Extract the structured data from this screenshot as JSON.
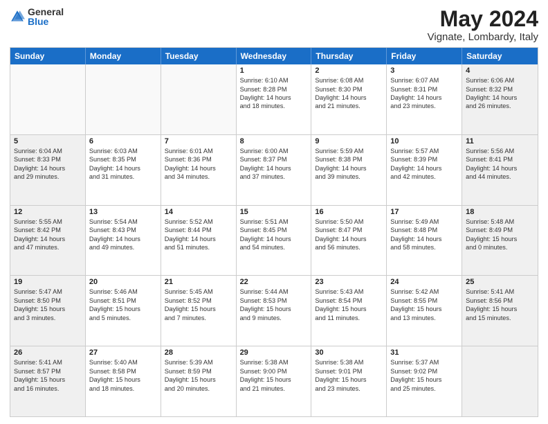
{
  "logo": {
    "general": "General",
    "blue": "Blue"
  },
  "title": {
    "month": "May 2024",
    "location": "Vignate, Lombardy, Italy"
  },
  "header_days": [
    "Sunday",
    "Monday",
    "Tuesday",
    "Wednesday",
    "Thursday",
    "Friday",
    "Saturday"
  ],
  "rows": [
    [
      {
        "day": "",
        "text": "",
        "empty": true
      },
      {
        "day": "",
        "text": "",
        "empty": true
      },
      {
        "day": "",
        "text": "",
        "empty": true
      },
      {
        "day": "1",
        "text": "Sunrise: 6:10 AM\nSunset: 8:28 PM\nDaylight: 14 hours\nand 18 minutes.",
        "empty": false
      },
      {
        "day": "2",
        "text": "Sunrise: 6:08 AM\nSunset: 8:30 PM\nDaylight: 14 hours\nand 21 minutes.",
        "empty": false
      },
      {
        "day": "3",
        "text": "Sunrise: 6:07 AM\nSunset: 8:31 PM\nDaylight: 14 hours\nand 23 minutes.",
        "empty": false
      },
      {
        "day": "4",
        "text": "Sunrise: 6:06 AM\nSunset: 8:32 PM\nDaylight: 14 hours\nand 26 minutes.",
        "empty": false,
        "shaded": true
      }
    ],
    [
      {
        "day": "5",
        "text": "Sunrise: 6:04 AM\nSunset: 8:33 PM\nDaylight: 14 hours\nand 29 minutes.",
        "empty": false,
        "shaded": true
      },
      {
        "day": "6",
        "text": "Sunrise: 6:03 AM\nSunset: 8:35 PM\nDaylight: 14 hours\nand 31 minutes.",
        "empty": false
      },
      {
        "day": "7",
        "text": "Sunrise: 6:01 AM\nSunset: 8:36 PM\nDaylight: 14 hours\nand 34 minutes.",
        "empty": false
      },
      {
        "day": "8",
        "text": "Sunrise: 6:00 AM\nSunset: 8:37 PM\nDaylight: 14 hours\nand 37 minutes.",
        "empty": false
      },
      {
        "day": "9",
        "text": "Sunrise: 5:59 AM\nSunset: 8:38 PM\nDaylight: 14 hours\nand 39 minutes.",
        "empty": false
      },
      {
        "day": "10",
        "text": "Sunrise: 5:57 AM\nSunset: 8:39 PM\nDaylight: 14 hours\nand 42 minutes.",
        "empty": false
      },
      {
        "day": "11",
        "text": "Sunrise: 5:56 AM\nSunset: 8:41 PM\nDaylight: 14 hours\nand 44 minutes.",
        "empty": false,
        "shaded": true
      }
    ],
    [
      {
        "day": "12",
        "text": "Sunrise: 5:55 AM\nSunset: 8:42 PM\nDaylight: 14 hours\nand 47 minutes.",
        "empty": false,
        "shaded": true
      },
      {
        "day": "13",
        "text": "Sunrise: 5:54 AM\nSunset: 8:43 PM\nDaylight: 14 hours\nand 49 minutes.",
        "empty": false
      },
      {
        "day": "14",
        "text": "Sunrise: 5:52 AM\nSunset: 8:44 PM\nDaylight: 14 hours\nand 51 minutes.",
        "empty": false
      },
      {
        "day": "15",
        "text": "Sunrise: 5:51 AM\nSunset: 8:45 PM\nDaylight: 14 hours\nand 54 minutes.",
        "empty": false
      },
      {
        "day": "16",
        "text": "Sunrise: 5:50 AM\nSunset: 8:47 PM\nDaylight: 14 hours\nand 56 minutes.",
        "empty": false
      },
      {
        "day": "17",
        "text": "Sunrise: 5:49 AM\nSunset: 8:48 PM\nDaylight: 14 hours\nand 58 minutes.",
        "empty": false
      },
      {
        "day": "18",
        "text": "Sunrise: 5:48 AM\nSunset: 8:49 PM\nDaylight: 15 hours\nand 0 minutes.",
        "empty": false,
        "shaded": true
      }
    ],
    [
      {
        "day": "19",
        "text": "Sunrise: 5:47 AM\nSunset: 8:50 PM\nDaylight: 15 hours\nand 3 minutes.",
        "empty": false,
        "shaded": true
      },
      {
        "day": "20",
        "text": "Sunrise: 5:46 AM\nSunset: 8:51 PM\nDaylight: 15 hours\nand 5 minutes.",
        "empty": false
      },
      {
        "day": "21",
        "text": "Sunrise: 5:45 AM\nSunset: 8:52 PM\nDaylight: 15 hours\nand 7 minutes.",
        "empty": false
      },
      {
        "day": "22",
        "text": "Sunrise: 5:44 AM\nSunset: 8:53 PM\nDaylight: 15 hours\nand 9 minutes.",
        "empty": false
      },
      {
        "day": "23",
        "text": "Sunrise: 5:43 AM\nSunset: 8:54 PM\nDaylight: 15 hours\nand 11 minutes.",
        "empty": false
      },
      {
        "day": "24",
        "text": "Sunrise: 5:42 AM\nSunset: 8:55 PM\nDaylight: 15 hours\nand 13 minutes.",
        "empty": false
      },
      {
        "day": "25",
        "text": "Sunrise: 5:41 AM\nSunset: 8:56 PM\nDaylight: 15 hours\nand 15 minutes.",
        "empty": false,
        "shaded": true
      }
    ],
    [
      {
        "day": "26",
        "text": "Sunrise: 5:41 AM\nSunset: 8:57 PM\nDaylight: 15 hours\nand 16 minutes.",
        "empty": false,
        "shaded": true
      },
      {
        "day": "27",
        "text": "Sunrise: 5:40 AM\nSunset: 8:58 PM\nDaylight: 15 hours\nand 18 minutes.",
        "empty": false
      },
      {
        "day": "28",
        "text": "Sunrise: 5:39 AM\nSunset: 8:59 PM\nDaylight: 15 hours\nand 20 minutes.",
        "empty": false
      },
      {
        "day": "29",
        "text": "Sunrise: 5:38 AM\nSunset: 9:00 PM\nDaylight: 15 hours\nand 21 minutes.",
        "empty": false
      },
      {
        "day": "30",
        "text": "Sunrise: 5:38 AM\nSunset: 9:01 PM\nDaylight: 15 hours\nand 23 minutes.",
        "empty": false
      },
      {
        "day": "31",
        "text": "Sunrise: 5:37 AM\nSunset: 9:02 PM\nDaylight: 15 hours\nand 25 minutes.",
        "empty": false
      },
      {
        "day": "",
        "text": "",
        "empty": true,
        "shaded": true
      }
    ]
  ]
}
